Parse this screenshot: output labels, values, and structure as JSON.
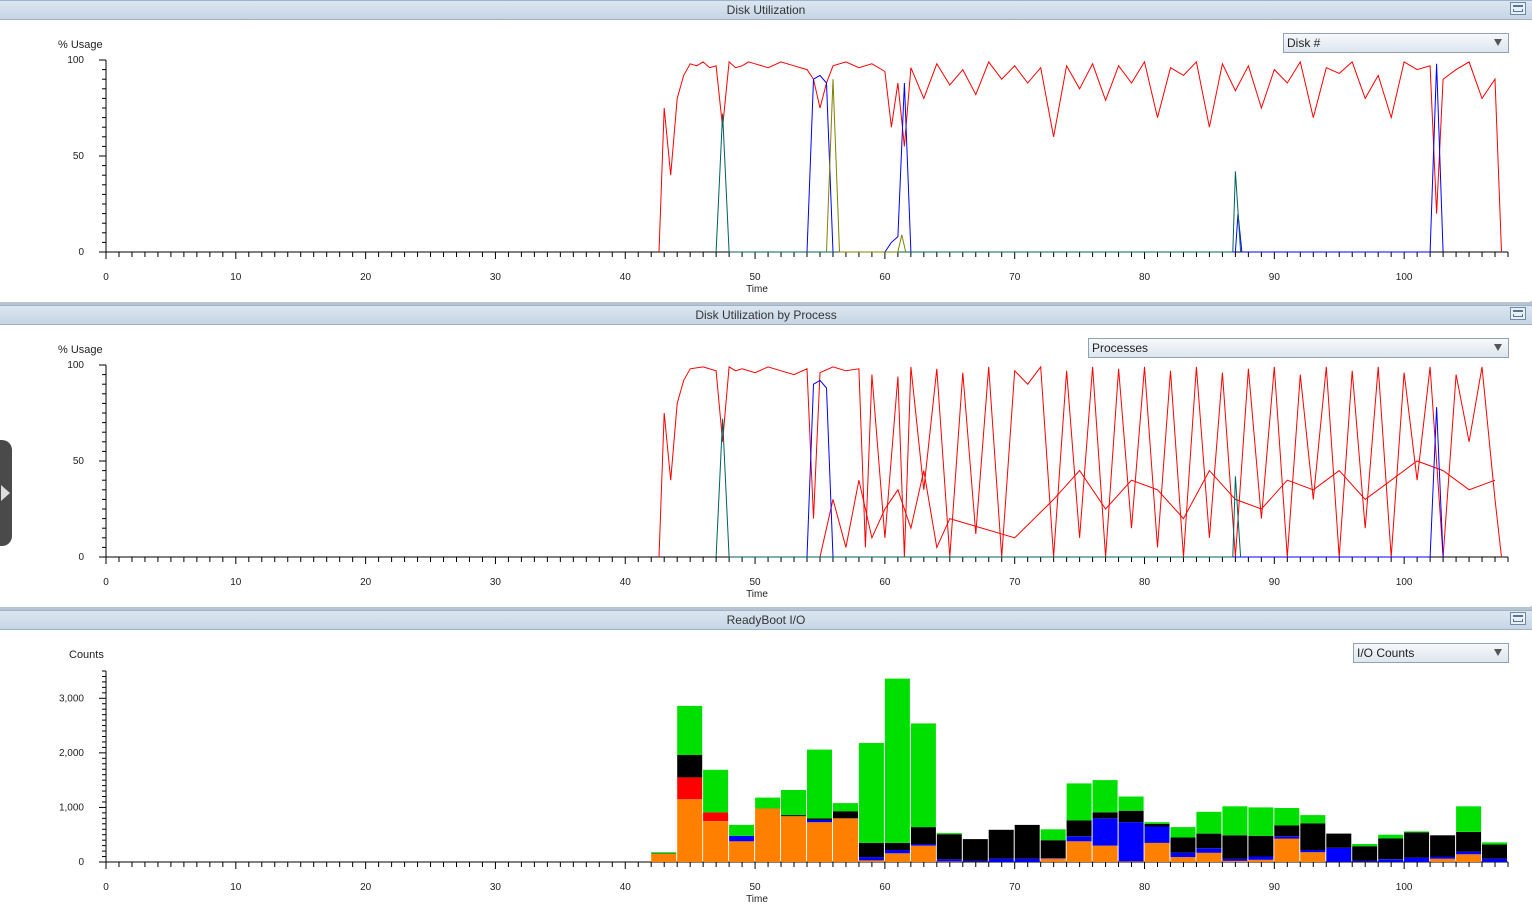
{
  "panels": [
    {
      "title": "Disk Utilization",
      "dropdown": "Disk #",
      "ylabel": "% Usage",
      "xlabel": "Time"
    },
    {
      "title": "Disk Utilization by Process",
      "dropdown": "Processes",
      "ylabel": "% Usage",
      "xlabel": "Time"
    },
    {
      "title": "ReadyBoot I/O",
      "dropdown": "I/O Counts",
      "ylabel": "Counts",
      "xlabel": "Time"
    }
  ],
  "colors": {
    "red": "#ff0000",
    "blue": "#0000ff",
    "green": "#00e000",
    "black": "#000000",
    "orange": "#ff8000",
    "purple": "#8000a0",
    "teal": "#006060",
    "olive": "#808000"
  },
  "chart_data": [
    {
      "type": "line",
      "title": "Disk Utilization",
      "xlabel": "Time",
      "ylabel": "% Usage",
      "xlim": [
        0,
        108
      ],
      "ylim": [
        0,
        100
      ],
      "xticks": [
        0,
        10,
        20,
        30,
        40,
        50,
        60,
        70,
        80,
        90,
        100
      ],
      "yticks": [
        0,
        50,
        100
      ],
      "series": [
        {
          "color": "red",
          "x": [
            42.6,
            43,
            43.5,
            44,
            44.5,
            45,
            45.5,
            46,
            46.5,
            47,
            47.5,
            48,
            48.5,
            49,
            49.5,
            50,
            51,
            52,
            53,
            54,
            54.5,
            55,
            55.5,
            56,
            57,
            58,
            59,
            60,
            60.5,
            61,
            61.5,
            62,
            63,
            64,
            65,
            66,
            67,
            68,
            69,
            70,
            71,
            72,
            73,
            74,
            75,
            76,
            77,
            78,
            79,
            80,
            81,
            82,
            83,
            84,
            85,
            86,
            87,
            88,
            89,
            90,
            91,
            92,
            93,
            94,
            95,
            96,
            97,
            98,
            99,
            100,
            101,
            102,
            102.5,
            103,
            104,
            105,
            106,
            107,
            107.5
          ],
          "y": [
            0,
            75,
            40,
            80,
            92,
            98,
            97,
            99,
            96,
            97,
            65,
            99,
            96,
            97,
            99,
            98,
            96,
            99,
            97,
            95,
            90,
            75,
            88,
            97,
            99,
            96,
            98,
            94,
            65,
            88,
            55,
            96,
            80,
            98,
            87,
            95,
            82,
            99,
            90,
            97,
            88,
            96,
            60,
            97,
            85,
            98,
            79,
            97,
            88,
            99,
            70,
            96,
            92,
            99,
            65,
            98,
            84,
            97,
            75,
            95,
            88,
            99,
            70,
            96,
            93,
            99,
            80,
            92,
            70,
            99,
            95,
            97,
            20,
            90,
            95,
            99,
            80,
            90,
            0
          ]
        },
        {
          "color": "blue",
          "x": [
            54,
            54.5,
            55,
            55.5,
            56,
            60,
            60.5,
            61,
            61.5,
            62,
            87,
            87.2,
            87.5,
            102,
            102.5,
            103
          ],
          "y": [
            0,
            90,
            92,
            88,
            0,
            0,
            5,
            8,
            88,
            0,
            0,
            20,
            0,
            0,
            98,
            0
          ]
        },
        {
          "color": "teal",
          "x": [
            47,
            47.5,
            48,
            86.8,
            87,
            87.4
          ],
          "y": [
            0,
            72,
            0,
            0,
            42,
            0
          ]
        },
        {
          "color": "olive",
          "x": [
            55.5,
            56,
            56.5,
            61,
            61.3,
            61.6
          ],
          "y": [
            0,
            90,
            0,
            0,
            9,
            0
          ]
        }
      ]
    },
    {
      "type": "line",
      "title": "Disk Utilization by Process",
      "xlabel": "Time",
      "ylabel": "% Usage",
      "xlim": [
        0,
        108
      ],
      "ylim": [
        0,
        100
      ],
      "xticks": [
        0,
        10,
        20,
        30,
        40,
        50,
        60,
        70,
        80,
        90,
        100
      ],
      "yticks": [
        0,
        50,
        100
      ],
      "series": [
        {
          "color": "red",
          "x": [
            42.6,
            43,
            43.5,
            44,
            44.5,
            45,
            46,
            47,
            47.5,
            48,
            48.5,
            49,
            50,
            51,
            52,
            53,
            54,
            54.5,
            55,
            56,
            57,
            58,
            58.5,
            59,
            60,
            61,
            61.5,
            62,
            63,
            64,
            65,
            66,
            67,
            68,
            69,
            70,
            71,
            72,
            73,
            74,
            75,
            76,
            77,
            78,
            79,
            80,
            81,
            82,
            83,
            84,
            85,
            86,
            87,
            88,
            89,
            90,
            91,
            92,
            93,
            94,
            95,
            96,
            97,
            98,
            99,
            100,
            101,
            102,
            103,
            104,
            105,
            106,
            107,
            107.5
          ],
          "y": [
            0,
            75,
            40,
            80,
            92,
            98,
            99,
            97,
            60,
            99,
            97,
            98,
            96,
            99,
            97,
            95,
            98,
            20,
            96,
            99,
            97,
            98,
            5,
            95,
            10,
            94,
            0,
            99,
            35,
            98,
            0,
            96,
            12,
            99,
            0,
            97,
            90,
            99,
            0,
            97,
            10,
            99,
            0,
            98,
            15,
            99,
            5,
            97,
            0,
            99,
            10,
            96,
            0,
            98,
            20,
            99,
            0,
            95,
            30,
            99,
            0,
            97,
            15,
            99,
            0,
            96,
            40,
            99,
            0,
            95,
            60,
            99,
            30,
            0
          ]
        },
        {
          "color": "red",
          "x": [
            55,
            56,
            57,
            58,
            59,
            60,
            61,
            62,
            63,
            64,
            65,
            70,
            73,
            75,
            77,
            79,
            81,
            83,
            85,
            87,
            89,
            91,
            93,
            95,
            97,
            99,
            101,
            103,
            105,
            107
          ],
          "y": [
            0,
            30,
            5,
            40,
            10,
            25,
            35,
            15,
            45,
            5,
            20,
            10,
            30,
            45,
            25,
            40,
            35,
            20,
            45,
            30,
            25,
            40,
            35,
            45,
            30,
            40,
            50,
            45,
            35,
            40
          ]
        },
        {
          "color": "blue",
          "x": [
            54,
            54.5,
            55,
            55.5,
            56,
            102,
            102.5,
            103
          ],
          "y": [
            0,
            90,
            92,
            88,
            0,
            0,
            78,
            0
          ]
        },
        {
          "color": "teal",
          "x": [
            47,
            47.5,
            48,
            86.8,
            87,
            87.4
          ],
          "y": [
            0,
            72,
            0,
            0,
            42,
            0
          ]
        }
      ]
    },
    {
      "type": "bar",
      "stacked": true,
      "title": "ReadyBoot I/O",
      "xlabel": "Time",
      "ylabel": "Counts",
      "xlim": [
        0,
        108
      ],
      "ylim": [
        0,
        3500
      ],
      "xticks": [
        0,
        10,
        20,
        30,
        40,
        50,
        60,
        70,
        80,
        90,
        100
      ],
      "yticks": [
        0,
        1000,
        2000,
        3000
      ],
      "ytick_labels": [
        "0",
        "1,000",
        "2,000",
        "3,000"
      ],
      "bin_width": 2,
      "x": [
        42,
        44,
        46,
        48,
        50,
        52,
        54,
        56,
        58,
        60,
        62,
        64,
        66,
        68,
        70,
        72,
        74,
        76,
        78,
        80,
        82,
        84,
        86,
        88,
        90,
        92,
        94,
        96,
        98,
        100,
        102,
        104,
        106
      ],
      "series": [
        {
          "color": "orange",
          "values": [
            150,
            1150,
            750,
            380,
            980,
            840,
            730,
            800,
            30,
            160,
            300,
            10,
            0,
            0,
            0,
            60,
            380,
            300,
            10,
            350,
            90,
            170,
            20,
            40,
            430,
            180,
            0,
            0,
            0,
            0,
            60,
            140,
            0
          ]
        },
        {
          "color": "blue",
          "values": [
            0,
            0,
            0,
            100,
            0,
            0,
            40,
            0,
            60,
            60,
            30,
            40,
            20,
            60,
            60,
            10,
            90,
            500,
            720,
            300,
            80,
            80,
            40,
            60,
            40,
            40,
            260,
            20,
            50,
            80,
            40,
            50,
            60
          ]
        },
        {
          "color": "red",
          "values": [
            0,
            400,
            160,
            0,
            0,
            0,
            0,
            0,
            0,
            0,
            0,
            0,
            0,
            0,
            0,
            0,
            0,
            0,
            0,
            0,
            0,
            0,
            0,
            0,
            0,
            0,
            0,
            0,
            0,
            0,
            0,
            0,
            0
          ]
        },
        {
          "color": "black",
          "values": [
            10,
            410,
            0,
            0,
            0,
            20,
            30,
            130,
            260,
            130,
            310,
            460,
            400,
            530,
            620,
            330,
            290,
            110,
            210,
            50,
            280,
            270,
            430,
            380,
            200,
            490,
            260,
            270,
            380,
            460,
            390,
            360,
            260
          ]
        },
        {
          "color": "green",
          "values": [
            20,
            900,
            780,
            200,
            200,
            460,
            1260,
            150,
            1830,
            3010,
            1900,
            20,
            0,
            0,
            0,
            200,
            680,
            590,
            260,
            30,
            190,
            400,
            530,
            520,
            320,
            150,
            0,
            40,
            70,
            20,
            0,
            470,
            40
          ]
        }
      ]
    }
  ]
}
